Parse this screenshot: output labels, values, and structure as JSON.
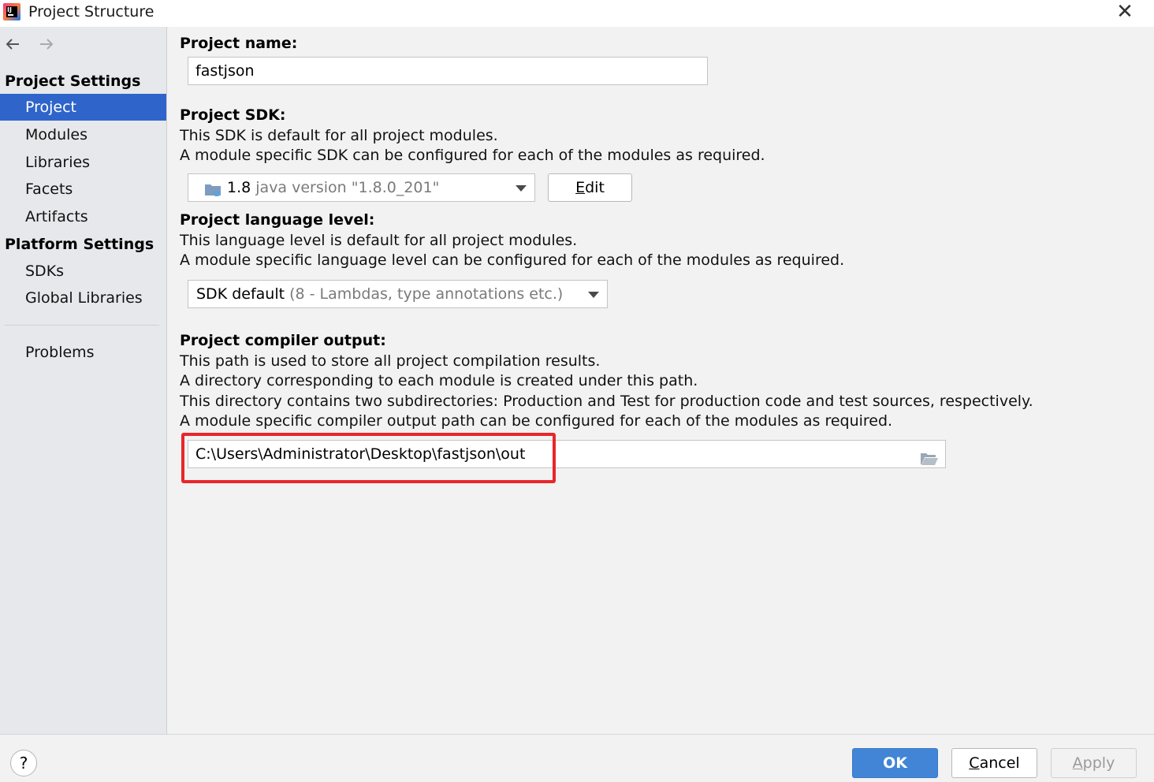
{
  "window": {
    "title": "Project Structure",
    "icon": "intellij-idea-icon",
    "close_icon": "close-icon"
  },
  "sidebar": {
    "back_icon": "arrow-left-icon",
    "forward_icon": "arrow-right-icon",
    "project_settings_header": "Project Settings",
    "project_settings_items": [
      "Project",
      "Modules",
      "Libraries",
      "Facets",
      "Artifacts"
    ],
    "platform_settings_header": "Platform Settings",
    "platform_settings_items": [
      "SDKs",
      "Global Libraries"
    ],
    "problems_label": "Problems",
    "selected_item": "Project",
    "selected_color": "#2f65ca"
  },
  "main": {
    "project_name": {
      "label": "Project name:",
      "value": "fastjson"
    },
    "project_sdk": {
      "label": "Project SDK:",
      "desc1": "This SDK is default for all project modules.",
      "desc2": "A module specific SDK can be configured for each of the modules as required.",
      "selected_version": "1.8",
      "selected_detail": "java version \"1.8.0_201\"",
      "sdk_icon": "folder-coffee-icon",
      "edit_label_prefix": "",
      "edit_mnemonic": "E",
      "edit_label_rest": "dit"
    },
    "language_level": {
      "label": "Project language level:",
      "desc1": "This language level is default for all project modules.",
      "desc2": "A module specific language level can be configured for each of the modules as required.",
      "selected_main": "SDK default",
      "selected_detail": "(8 - Lambdas, type annotations etc.)"
    },
    "compiler_output": {
      "label": "Project compiler output:",
      "desc1": "This path is used to store all project compilation results.",
      "desc2": "A directory corresponding to each module is created under this path.",
      "desc3": "This directory contains two subdirectories: Production and Test for production code and test sources, respectively.",
      "desc4": "A module specific compiler output path can be configured for each of the modules as required.",
      "path": "C:\\Users\\Administrator\\Desktop\\fastjson\\out",
      "browse_icon": "folder-open-icon",
      "highlight_color": "#e8262b"
    }
  },
  "footer": {
    "help_label": "?",
    "ok_label": "OK",
    "cancel_mnemonic": "C",
    "cancel_rest": "ancel",
    "apply_mnemonic": "A",
    "apply_rest": "pply",
    "ok_color": "#4285d6"
  }
}
